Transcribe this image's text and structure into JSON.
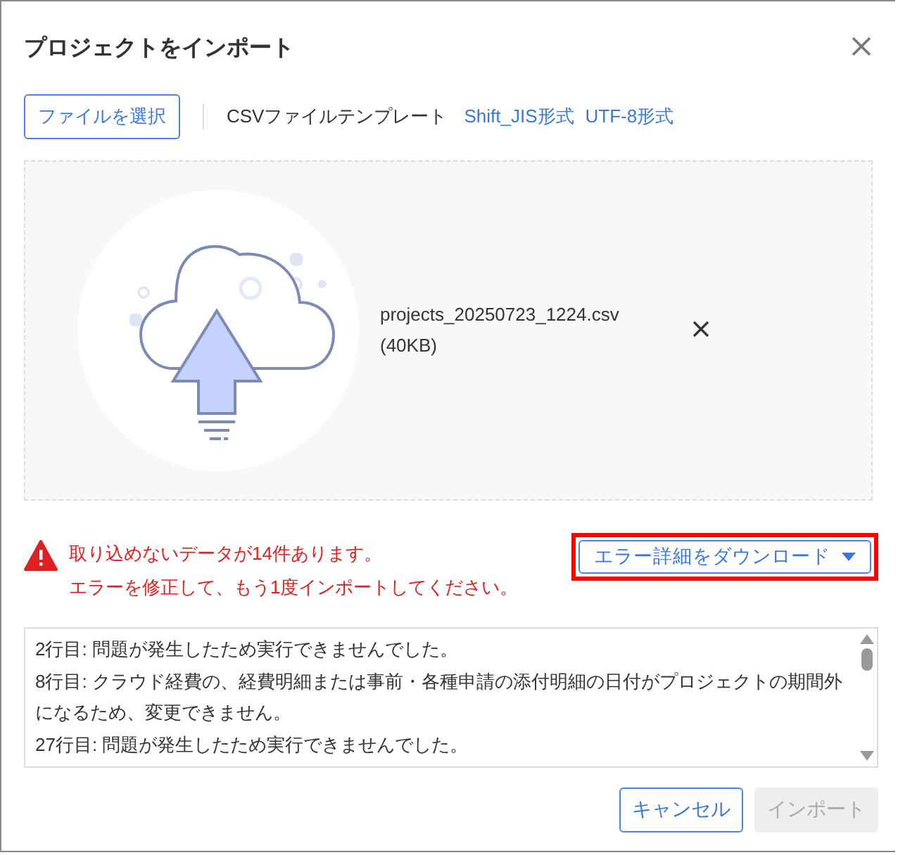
{
  "dialog": {
    "title": "プロジェクトをインポート"
  },
  "toolbar": {
    "select_button": "ファイルを選択",
    "template_label": "CSVファイルテンプレート",
    "links": [
      "Shift_JIS形式",
      "UTF-8形式"
    ]
  },
  "upload": {
    "file_name": "projects_20250723_1224.csv",
    "file_size": "(40KB)"
  },
  "error": {
    "lines": [
      "取り込めないデータが14件あります。",
      "エラーを修正して、もう1度インポートしてください。"
    ],
    "download_button": "エラー詳細をダウンロード",
    "highlighted": true
  },
  "error_list": [
    "2行目: 問題が発生したため実行できませんでした。",
    "8行目: クラウド経費の、経費明細または事前・各種申請の添付明細の日付がプロジェクトの期間外になるため、変更できません。",
    "27行目: 問題が発生したため実行できませんでした。"
  ],
  "footer": {
    "buttons": [
      {
        "label": "キャンセル",
        "disabled": false
      },
      {
        "label": "インポート",
        "disabled": true
      }
    ]
  }
}
